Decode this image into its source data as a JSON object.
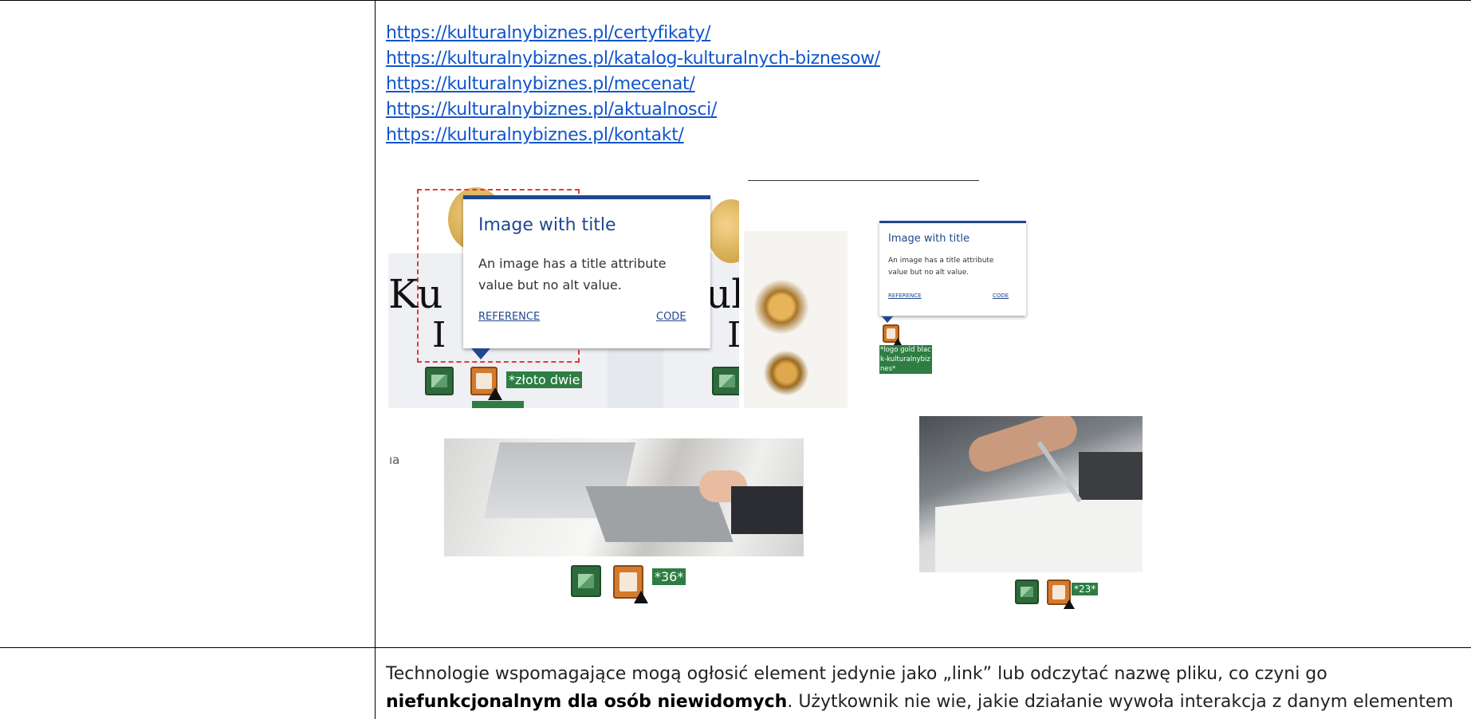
{
  "links": [
    "https://kulturalnybiznes.pl/certyfikaty/",
    "https://kulturalnybiznes.pl/katalog-kulturalnych-biznesow/",
    "https://kulturalnybiznes.pl/mecenat/",
    "https://kulturalnybiznes.pl/aktualnosci/",
    "https://kulturalnybiznes.pl/kontakt/"
  ],
  "screenshot_large": {
    "tooltip_title": "Image with title",
    "tooltip_desc": "An image has a title attribute value but no alt value.",
    "tooltip_reference": "REFERENCE",
    "tooltip_code": "CODE",
    "logo_text_left": "Ku",
    "logo_text_left2": "I",
    "logo_text_right": "ul",
    "logo_text_right2": "I",
    "alt_tag": "*złoto dwie"
  },
  "screenshot_small": {
    "tooltip_title": "Image with title",
    "tooltip_desc": "An image has a title attribute value but no alt value.",
    "tooltip_reference": "REFERENCE",
    "tooltip_code": "CODE",
    "alt_tag": "*logo gold black-kulturalnybiznes*"
  },
  "photo_meeting": {
    "side_text": "ıa",
    "alt_tag": "*36*"
  },
  "photo_pen": {
    "alt_tag": "*23*"
  },
  "paragraph": {
    "part1": "Technologie wspomagające mogą ogłosić element jedynie jako „link” lub odczytać nazwę pliku, co czyni go ",
    "bold": "niefunkcjonalnym dla osób niewidomych",
    "part2": ". Użytkownik nie wie, jakie działanie wywoła interakcja z danym elementem"
  },
  "colors": {
    "link": "#1155cc",
    "tooltip_accent": "#20478f",
    "tag_bg": "#2e7d43",
    "icon_orange": "#d37a2e"
  }
}
